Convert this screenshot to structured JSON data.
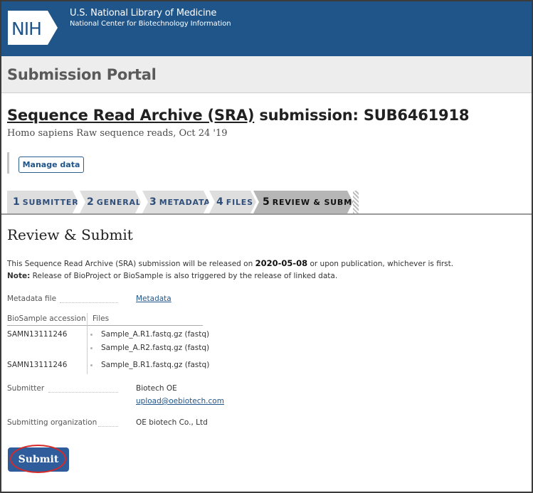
{
  "header": {
    "logo_text": "NIH",
    "line1": "U.S. National Library of Medicine",
    "line2": "National Center for Biotechnology Information",
    "colors": {
      "banner": "#20558a"
    }
  },
  "portal": {
    "title": "Submission Portal"
  },
  "submission": {
    "title_link": "Sequence Read Archive (SRA)",
    "title_rest": " submission: SUB6461918",
    "subtitle": "Homo sapiens Raw sequence reads, Oct 24 '19",
    "manage_button": "Manage data"
  },
  "steps": [
    {
      "num": "1",
      "label": "SUBMITTER",
      "active": false
    },
    {
      "num": "2",
      "label": "GENERAL",
      "active": false
    },
    {
      "num": "3",
      "label": "METADATA",
      "active": false
    },
    {
      "num": "4",
      "label": "FILES",
      "active": false
    },
    {
      "num": "5",
      "label": "REVIEW & SUBMIT",
      "active": true
    }
  ],
  "review": {
    "heading": "Review & Submit",
    "release_prefix": "This Sequence Read Archive (SRA) submission will be released on ",
    "release_date": "2020-05-08",
    "release_suffix": " or upon publication, whichever is first.",
    "note_label": "Note:",
    "note_text": " Release of BioProject or BioSample is also triggered by the release of linked data.",
    "metadata_label": "Metadata file",
    "metadata_link": "Metadata",
    "table": {
      "headers": [
        "BioSample accession",
        "Files"
      ],
      "rows": [
        {
          "accession": "SAMN13111246",
          "files": [
            "Sample_A.R1.fastq.gz (fastq)",
            "Sample_A.R2.fastq.gz (fastq)"
          ]
        },
        {
          "accession": "SAMN13111246",
          "files": [
            "Sample_B.R1.fastq.gz (fastq)"
          ]
        }
      ]
    },
    "submitter_label": "Submitter",
    "submitter_name": "Biotech OE",
    "submitter_email": "upload@oebiotech.com",
    "org_label": "Submitting organization",
    "org_name": "OE biotech Co., Ltd",
    "submit_button": "Submit"
  }
}
